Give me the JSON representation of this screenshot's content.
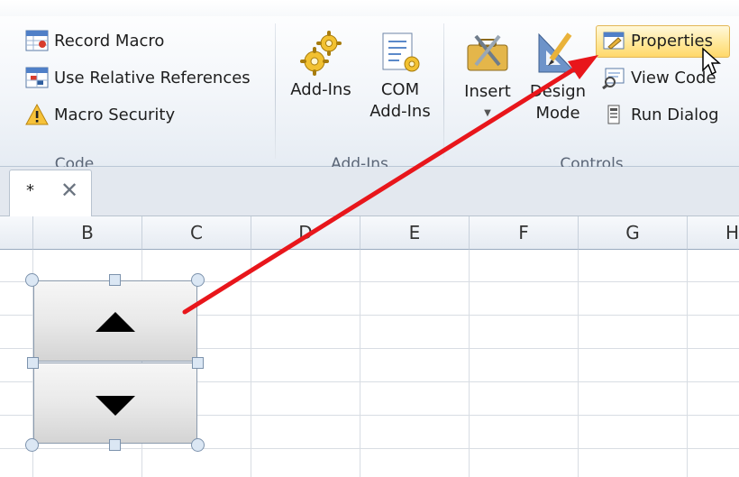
{
  "ribbon": {
    "code_group": {
      "label": "Code",
      "record_macro": "Record Macro",
      "use_relative_references": "Use Relative References",
      "macro_security": "Macro Security"
    },
    "addins_group": {
      "label": "Add-Ins",
      "addins": "Add-Ins",
      "com_addins_1": "COM",
      "com_addins_2": "Add-Ins"
    },
    "controls_group": {
      "label": "Controls",
      "insert": "Insert",
      "design_mode_1": "Design",
      "design_mode_2": "Mode",
      "properties": "Properties",
      "view_code": "View Code",
      "run_dialog": "Run Dialog"
    }
  },
  "tabs": {
    "star": "*",
    "close": "✕"
  },
  "columns": [
    "B",
    "C",
    "D",
    "E",
    "F",
    "G",
    "H"
  ],
  "colors": {
    "arrow": "#e8161b",
    "highlight": "#ffe89a"
  }
}
